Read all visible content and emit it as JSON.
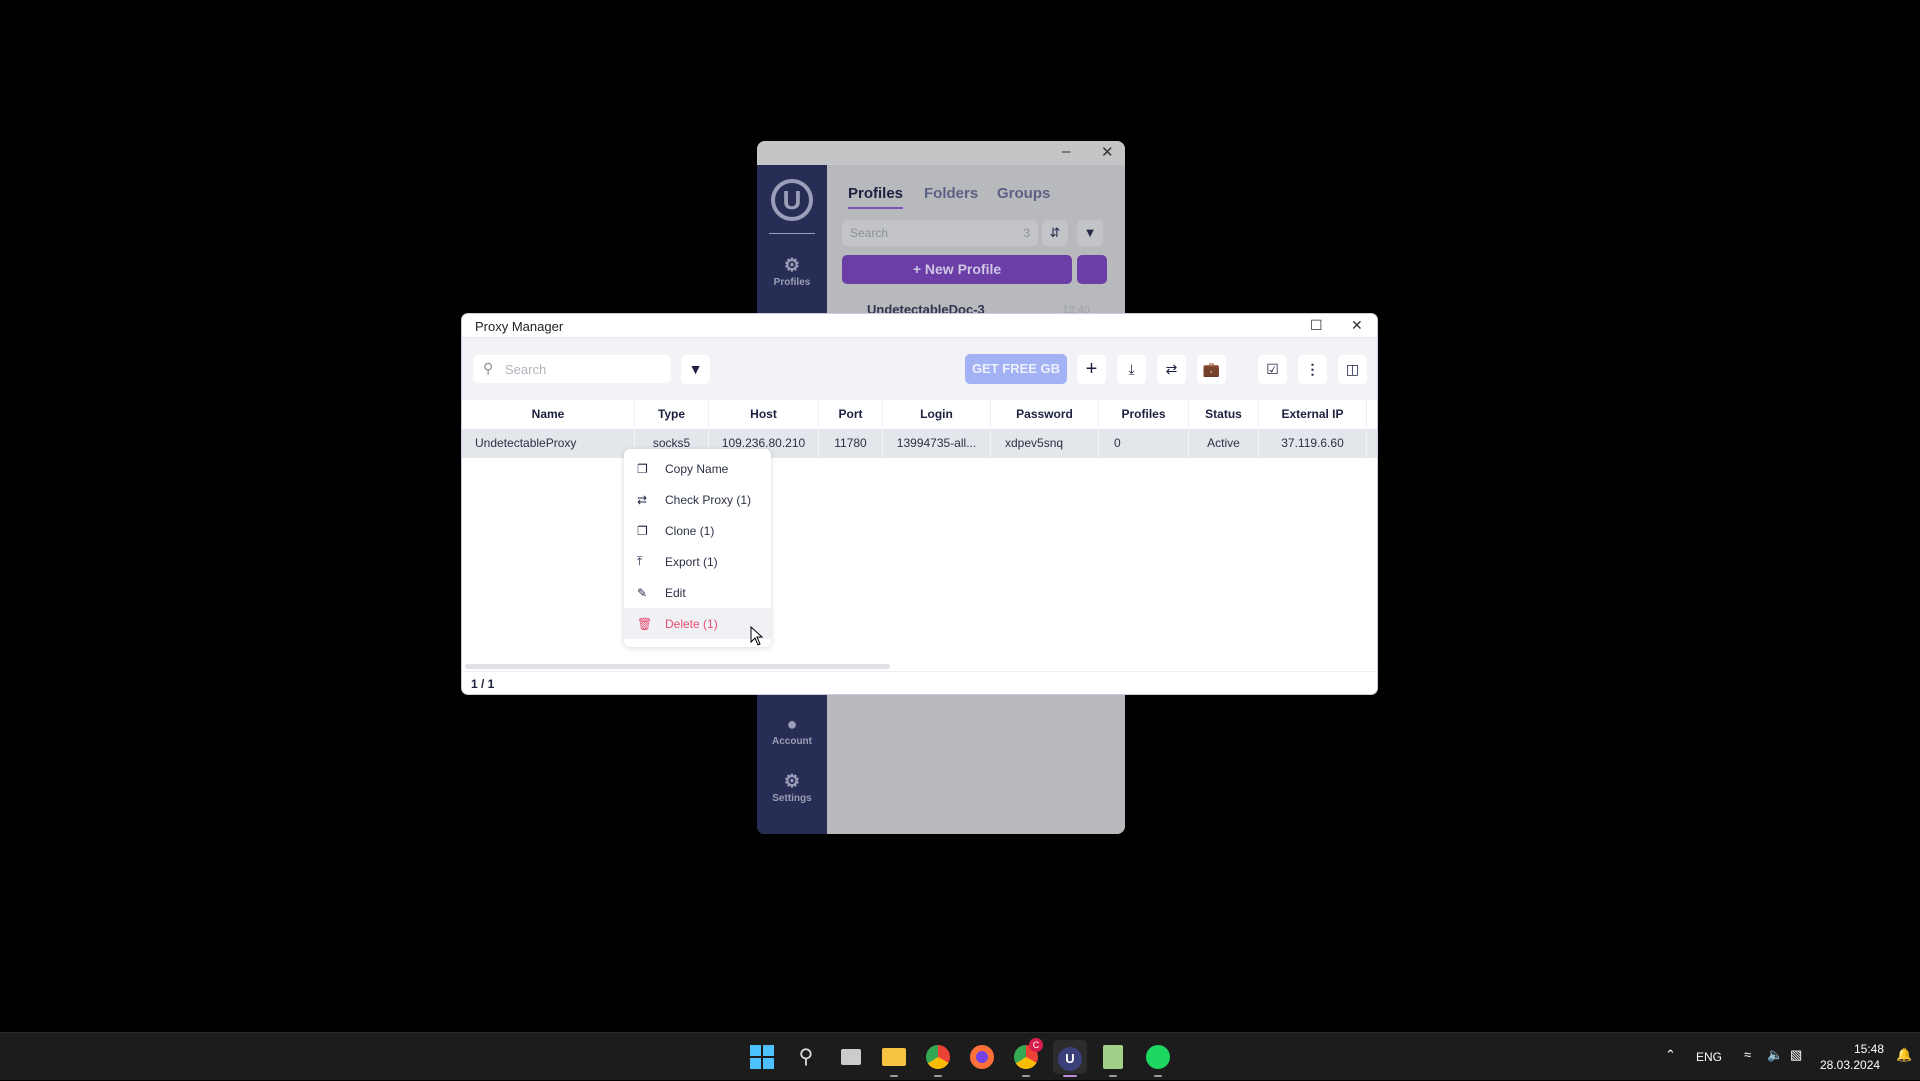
{
  "background_app": {
    "tabs": [
      {
        "label": "Profiles",
        "active": true
      },
      {
        "label": "Folders"
      },
      {
        "label": "Groups"
      }
    ],
    "search_placeholder": "Search",
    "search_count": "3",
    "new_profile_label": "New Profile",
    "profile_item": {
      "name": "UndetectableDoc-3",
      "time": "13:40"
    },
    "nav": {
      "profiles": "Profiles",
      "account": "Account",
      "settings": "Settings"
    }
  },
  "proxy_manager": {
    "title": "Proxy Manager",
    "search_placeholder": "Search",
    "get_free_label": "GET FREE GB",
    "columns": [
      "Name",
      "Type",
      "Host",
      "Port",
      "Login",
      "Password",
      "Profiles",
      "Status",
      "External IP"
    ],
    "rows": [
      {
        "name": "UndetectableProxy",
        "type": "socks5",
        "host": "109.236.80.210",
        "port": "11780",
        "login": "13994735-all...",
        "password": "xdpev5snq",
        "profiles": "0",
        "status": "Active",
        "external_ip": "37.119.6.60"
      }
    ],
    "pagination": "1 / 1"
  },
  "context_menu": {
    "items": [
      {
        "label": "Copy Name",
        "icon": "copy-icon"
      },
      {
        "label": "Check Proxy (1)",
        "icon": "swap-arrows-icon"
      },
      {
        "label": "Clone (1)",
        "icon": "clone-icon"
      },
      {
        "label": "Export (1)",
        "icon": "export-icon"
      },
      {
        "label": "Edit",
        "icon": "edit-icon"
      },
      {
        "label": "Delete (1)",
        "icon": "trash-icon",
        "danger": true
      }
    ]
  },
  "taskbar": {
    "apps": [
      "start",
      "search",
      "task-view",
      "file-explorer",
      "chrome",
      "firefox",
      "chrome-profile",
      "undetectable",
      "notepad",
      "spotify"
    ],
    "chrome_profile_badge": "C",
    "language": "ENG",
    "time": "15:48",
    "date": "28.03.2024"
  },
  "colors": {
    "accent": "#6a3ea6",
    "danger": "#e54b73",
    "get_free": "#a3b2f5",
    "sidebar": "#272d55"
  }
}
